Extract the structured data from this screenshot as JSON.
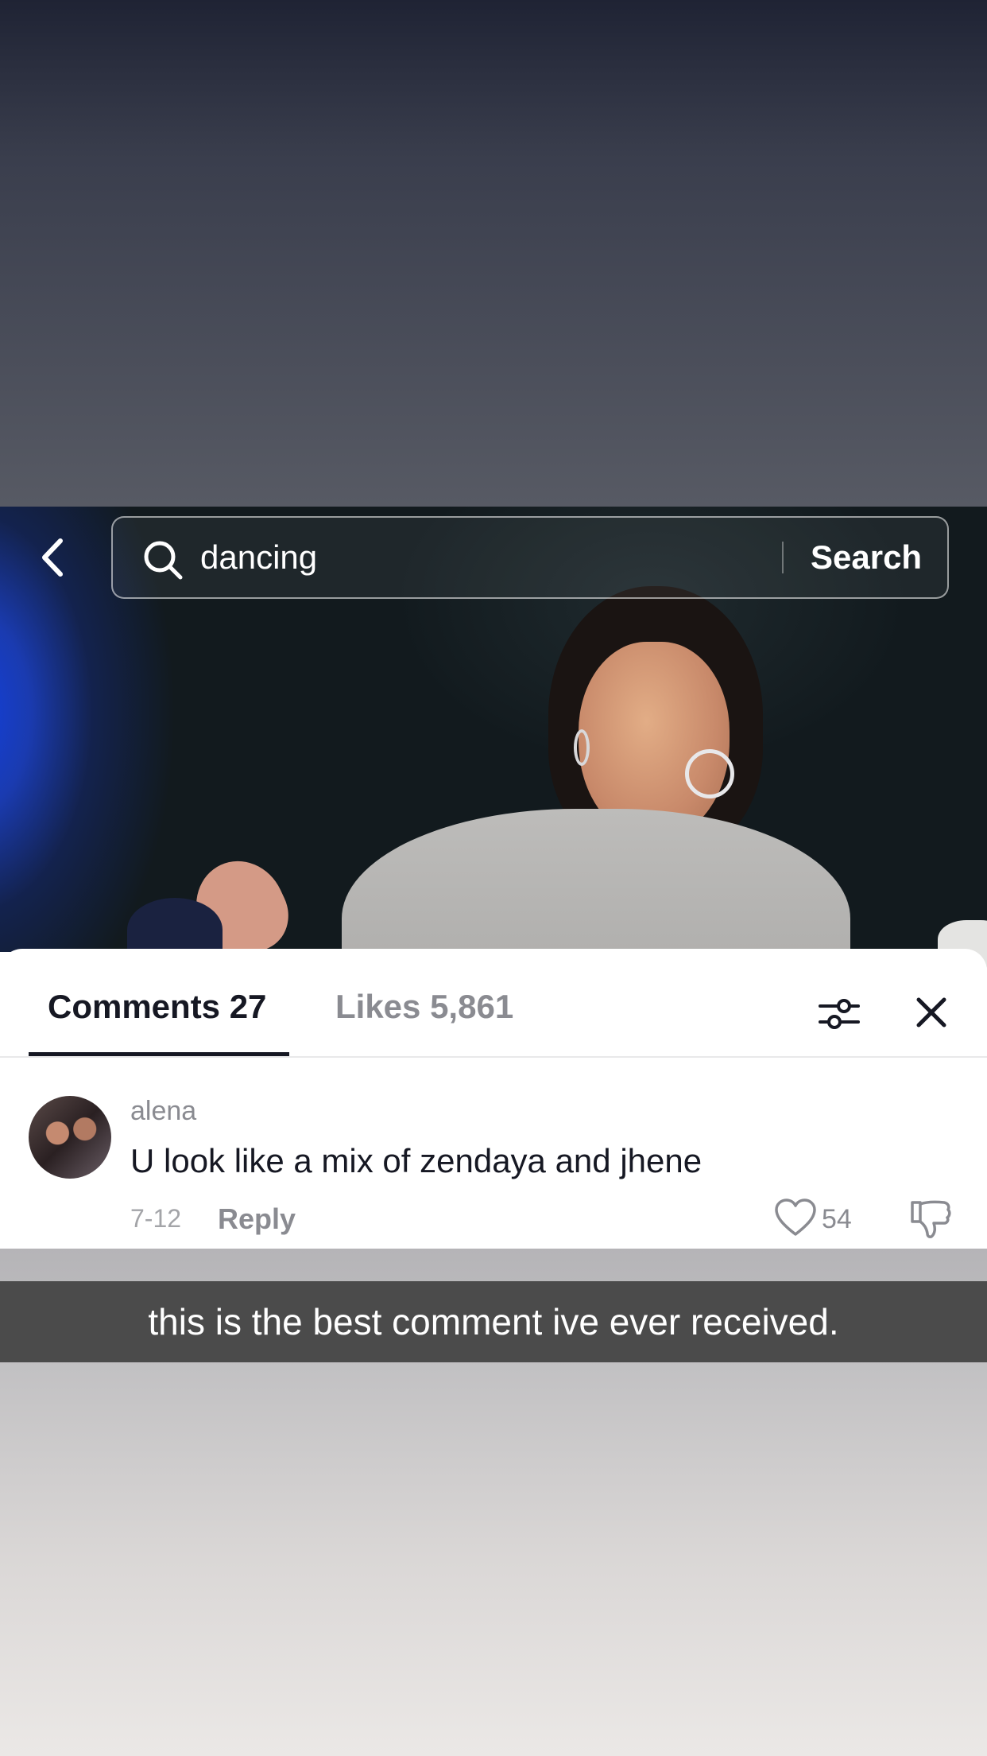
{
  "search": {
    "query": "dancing",
    "button_label": "Search"
  },
  "tabs": {
    "comments_label": "Comments 27",
    "likes_label": "Likes 5,861"
  },
  "comment": {
    "username": "alena",
    "text": "U look like a mix of zendaya and jhene",
    "date": "7-12",
    "reply_label": "Reply",
    "like_count": "54"
  },
  "caption": "this is the best comment ive ever received.",
  "icons": [
    "back-chevron-icon",
    "search-icon",
    "filter-icon",
    "close-icon",
    "heart-icon",
    "dislike-icon"
  ],
  "colors": {
    "text_primary": "#161823",
    "text_secondary": "#8a8b91",
    "caption_background": "#4b4b4b"
  }
}
